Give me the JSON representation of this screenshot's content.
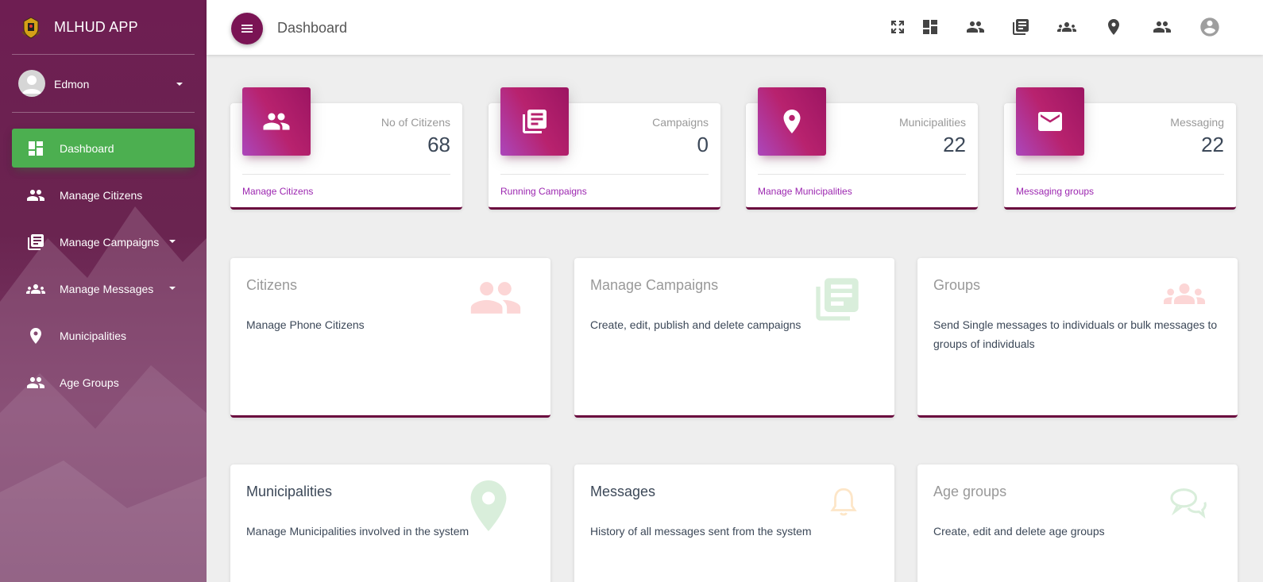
{
  "app": {
    "title": "MLHUD APP"
  },
  "user": {
    "name": "Edmon"
  },
  "sidebar": {
    "items": [
      {
        "label": "Dashboard",
        "icon": "dashboard-icon",
        "active": true
      },
      {
        "label": "Manage Citizens",
        "icon": "people-icon"
      },
      {
        "label": "Manage Campaigns",
        "icon": "library-books-icon",
        "dropdown": true
      },
      {
        "label": "Manage Messages",
        "icon": "group-icon",
        "dropdown": true
      },
      {
        "label": "Municipalities",
        "icon": "location-pin-icon"
      },
      {
        "label": "Age Groups",
        "icon": "people-icon"
      }
    ]
  },
  "topbar": {
    "title": "Dashboard",
    "icons": [
      "fullscreen-icon",
      "dashboard-icon",
      "people-icon",
      "library-books-icon",
      "group-icon",
      "location-pin-icon",
      "people-icon",
      "account-circle-icon"
    ]
  },
  "stats": [
    {
      "category": "No of Citizens",
      "value": "68",
      "link": "Manage Citizens",
      "icon": "people-icon"
    },
    {
      "category": "Campaigns",
      "value": "0",
      "link": "Running Campaigns",
      "icon": "library-books-icon"
    },
    {
      "category": "Municipalities",
      "value": "22",
      "link": "Manage Municipalities",
      "icon": "location-pin-icon"
    },
    {
      "category": "Messaging",
      "value": "22",
      "link": "Messaging groups",
      "icon": "mail-icon"
    }
  ],
  "cards": [
    {
      "title": "Citizens",
      "desc": "Manage Phone Citizens",
      "icon": "people-icon"
    },
    {
      "title": "Manage Campaigns",
      "desc": "Create, edit, publish and delete campaigns",
      "icon": "library-books-icon"
    },
    {
      "title": "Groups",
      "desc": "Send Single messages to individuals or bulk messages to groups of individuals",
      "icon": "group-icon"
    },
    {
      "title": "Municipalities",
      "desc": "Manage Municipalities involved in the system",
      "icon": "location-pin-icon"
    },
    {
      "title": "Messages",
      "desc": "History of all messages sent from the system",
      "icon": "bell-icon"
    },
    {
      "title": "Age groups",
      "desc": "Create, edit and delete age groups",
      "icon": "chat-bubbles-icon"
    }
  ],
  "colors": {
    "sidebar": "#6e1e52",
    "active": "#4caf50",
    "accent": "#9c1562",
    "link": "#9c27b0"
  }
}
